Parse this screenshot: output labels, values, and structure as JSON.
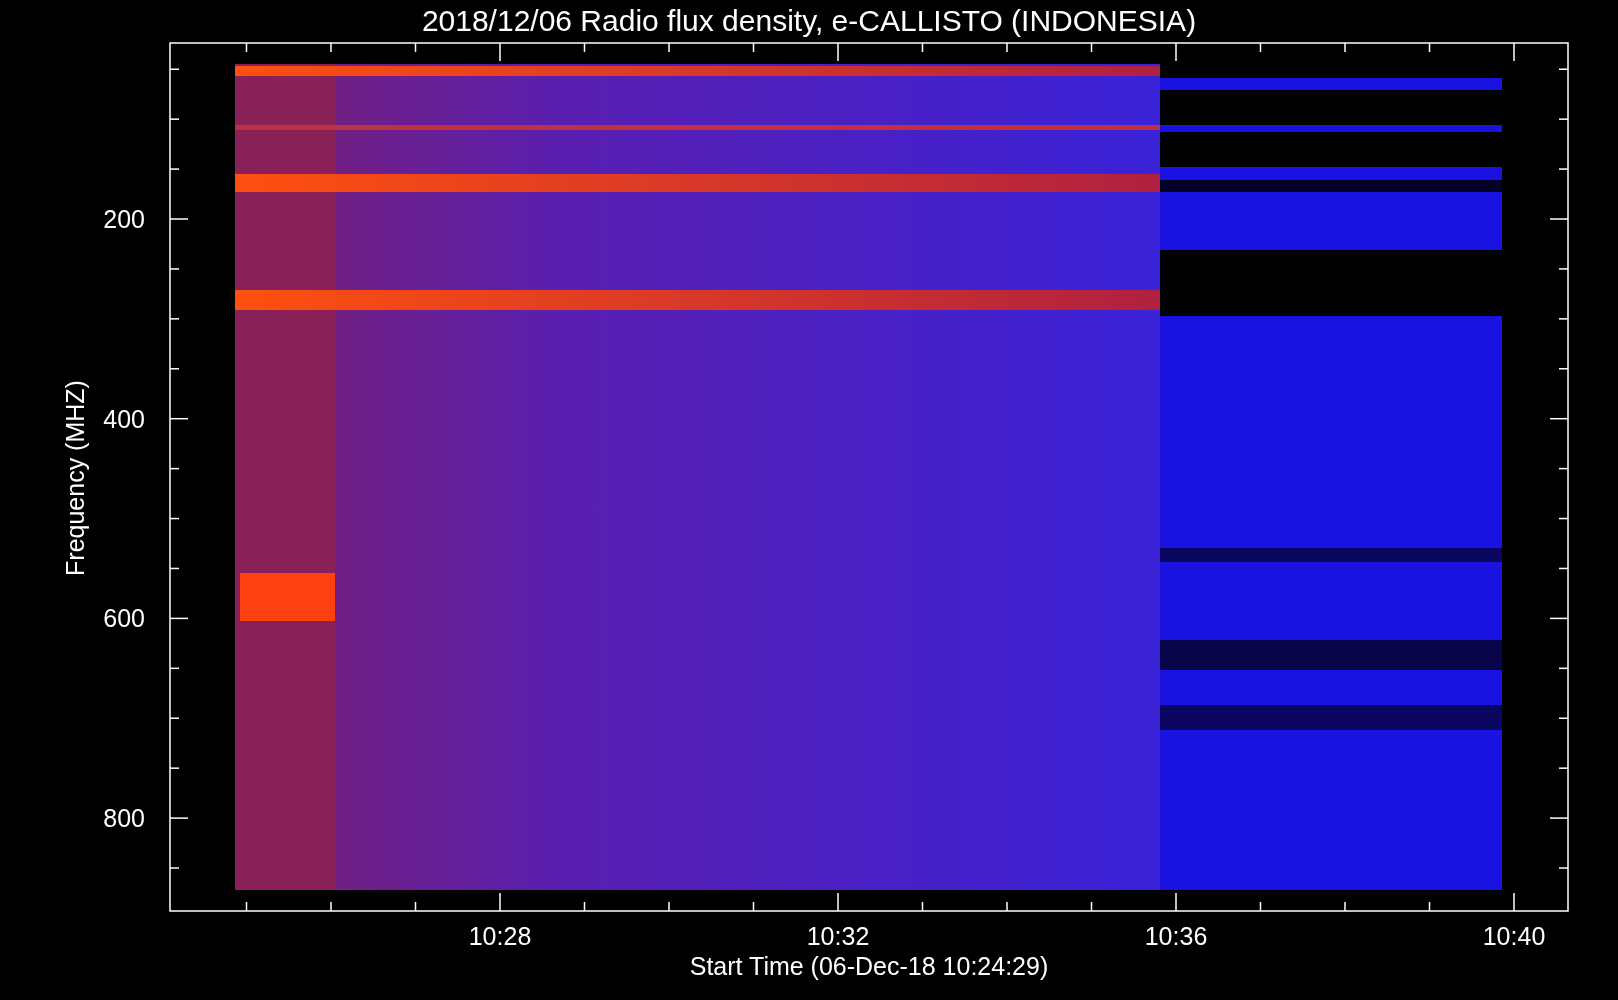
{
  "title": "2018/12/06  Radio flux density, e-CALLISTO (INDONESIA)",
  "y_axis": {
    "label": "Frequency (MHZ)",
    "ticks": [
      "200",
      "400",
      "600",
      "800"
    ]
  },
  "x_axis": {
    "label": "Start Time (06-Dec-18 10:24:29)",
    "ticks": [
      "10:28",
      "10:32",
      "10:36",
      "10:40"
    ]
  }
}
